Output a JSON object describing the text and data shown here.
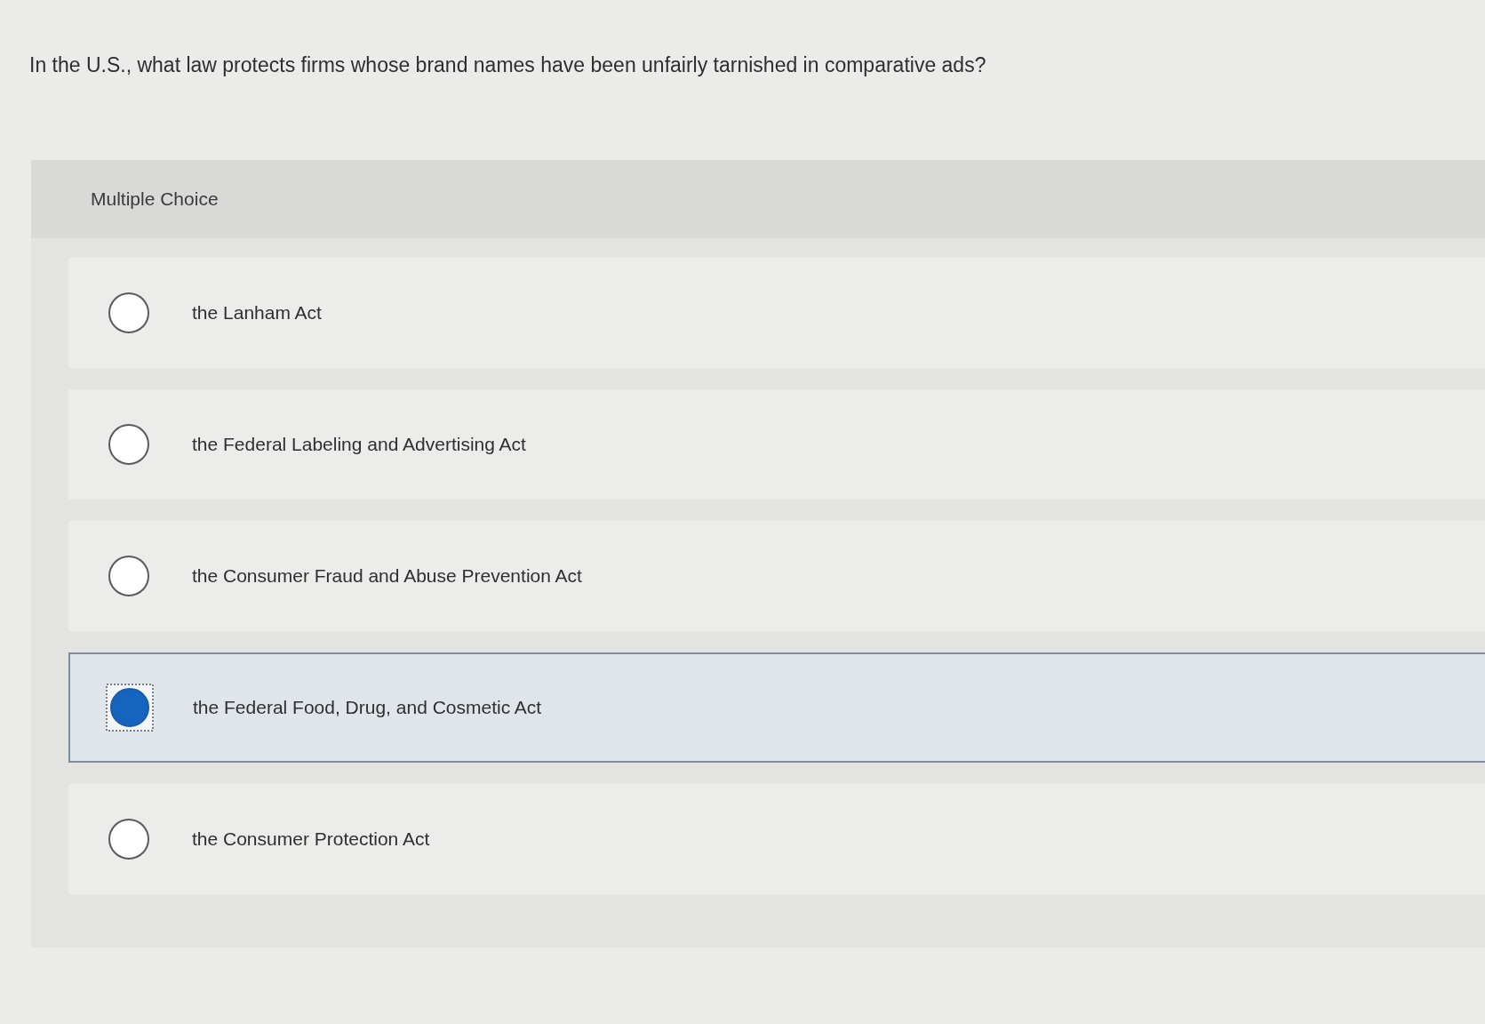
{
  "question": "In the U.S., what law protects firms whose brand names have been unfairly tarnished in comparative ads?",
  "panel": {
    "header": "Multiple Choice",
    "options": [
      {
        "label": "the Lanham Act",
        "selected": false
      },
      {
        "label": "the Federal Labeling and Advertising Act",
        "selected": false
      },
      {
        "label": "the Consumer Fraud and Abuse Prevention Act",
        "selected": false
      },
      {
        "label": "the Federal Food, Drug, and Cosmetic Act",
        "selected": true
      },
      {
        "label": "the Consumer Protection Act",
        "selected": false
      }
    ]
  }
}
